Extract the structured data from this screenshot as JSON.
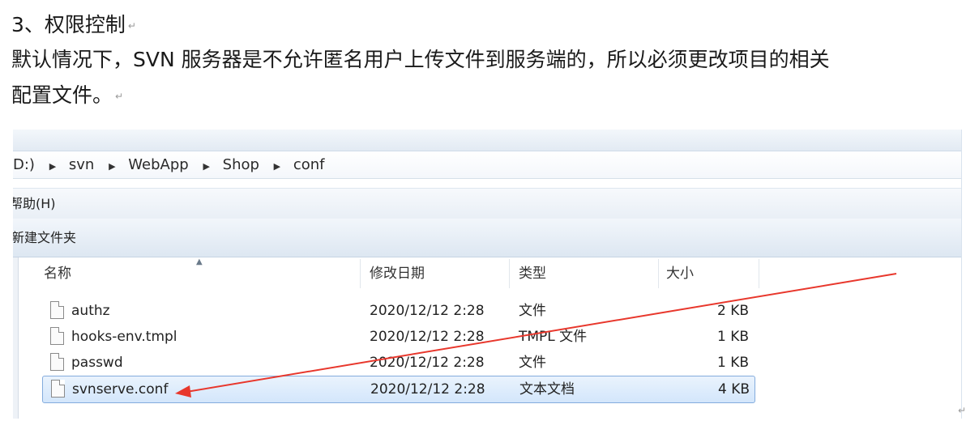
{
  "document": {
    "heading": "3、权限控制",
    "paragraph_line1": "默认情况下，SVN 服务器是不允许匿名用户上传文件到服务端的，所以必须更改项目的相关",
    "paragraph_line2": "配置文件。",
    "return_mark": "↵"
  },
  "explorer": {
    "breadcrumb": [
      "D:)",
      "svn",
      "WebApp",
      "Shop",
      "conf"
    ],
    "menu_help": "帮助(H)",
    "toolbar_new_folder": "新建文件夹",
    "columns": {
      "name": "名称",
      "modified": "修改日期",
      "type": "类型",
      "size": "大小"
    },
    "files": [
      {
        "name": "authz",
        "modified": "2020/12/12 2:28",
        "type": "文件",
        "size": "2 KB"
      },
      {
        "name": "hooks-env.tmpl",
        "modified": "2020/12/12 2:28",
        "type": "TMPL 文件",
        "size": "1 KB"
      },
      {
        "name": "passwd",
        "modified": "2020/12/12 2:28",
        "type": "文件",
        "size": "1 KB"
      },
      {
        "name": "svnserve.conf",
        "modified": "2020/12/12 2:28",
        "type": "文本文档",
        "size": "4 KB"
      }
    ],
    "selected_file": "svnserve.conf",
    "annotation_arrow_color": "#e8372c"
  },
  "icons": {
    "file": "file-icon",
    "crumb_separator": "triangle-right-icon",
    "sort": "sort-up-icon"
  }
}
